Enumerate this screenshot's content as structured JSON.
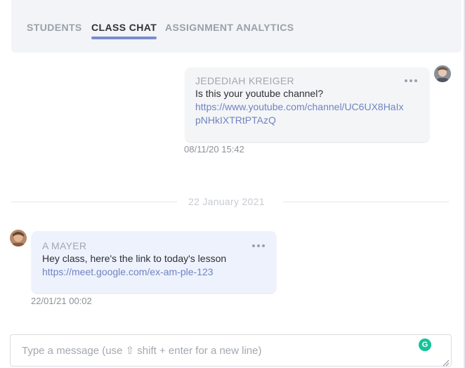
{
  "tabs": [
    {
      "label": "STUDENTS",
      "active": false
    },
    {
      "label": "CLASS CHAT",
      "active": true
    },
    {
      "label": "ASSIGNMENT ANALYTICS",
      "active": false
    }
  ],
  "messages": [
    {
      "sender": "JEDEDIAH KREIGER",
      "text": "Is this your youtube channel?",
      "link_line1": "https://www.youtube.com/channel/UC6UX8HaIx",
      "link_line2": "pNHkIXTRtPTAzQ",
      "timestamp": "08/11/20 15:42",
      "side": "right",
      "avatar_icon": "user-avatar"
    },
    {
      "sender": "A MAYER",
      "text": "Hey class, here's the link to today's lesson",
      "link_line1": "https://meet.google.com/ex-am-ple-123",
      "timestamp": "22/01/21 00:02",
      "side": "left",
      "avatar_icon": "user-avatar"
    }
  ],
  "date_divider": "22 January 2021",
  "composer": {
    "placeholder": "Type a message (use ⇧ shift + enter for a new line)",
    "value": ""
  },
  "icons": {
    "more": "more-dots-icon",
    "grammarly": "grammarly-icon",
    "grammarly_glyph": "G"
  },
  "colors": {
    "accent": "#7b8ccc",
    "link": "#6f84c2",
    "bubble_incoming": "#eef2fc",
    "bubble_outgoing": "#f4f5f7",
    "grammarly": "#15c39a"
  }
}
